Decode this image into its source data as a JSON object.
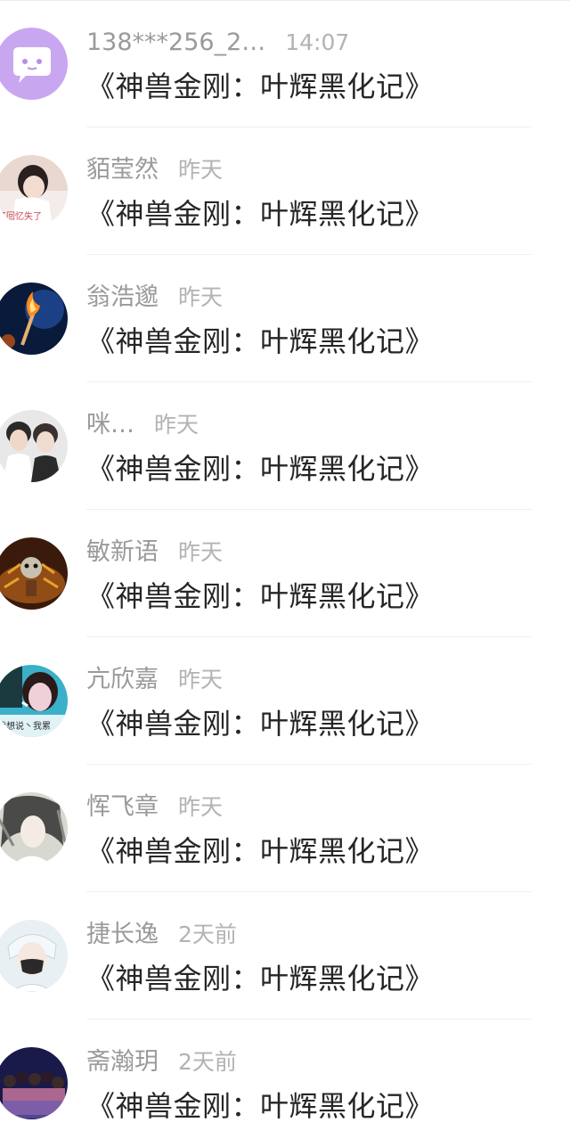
{
  "messages": [
    {
      "name": "138***256_2…",
      "time": "14:07",
      "text": "《神兽金刚：叶辉黑化记》",
      "avatar": "robot-chat-avatar",
      "avatar_colors": [
        "#c9a7f0",
        "#b590e8"
      ]
    },
    {
      "name": "貊莹然",
      "time": "昨天",
      "text": "《神兽金刚：叶辉黑化记》",
      "avatar": "girl-photo-avatar",
      "avatar_colors": [
        "#e8d8d0",
        "#c94a5a"
      ],
      "avatar_caption": "了回忆失了"
    },
    {
      "name": "翁浩邈",
      "time": "昨天",
      "text": "《神兽金刚：叶辉黑化记》",
      "avatar": "burning-match-avatar",
      "avatar_colors": [
        "#0a1a3a",
        "#ff8a1a"
      ]
    },
    {
      "name": "咪…",
      "time": "昨天",
      "text": "《神兽金刚：叶辉黑化记》",
      "avatar": "two-boys-avatar",
      "avatar_colors": [
        "#e8e8e8",
        "#2a2a2a"
      ]
    },
    {
      "name": "敏新语",
      "time": "昨天",
      "text": "《神兽金刚：叶辉黑化记》",
      "avatar": "dark-creature-avatar",
      "avatar_colors": [
        "#3a1a0a",
        "#e8a030"
      ]
    },
    {
      "name": "亢欣嘉",
      "time": "昨天",
      "text": "《神兽金刚：叶辉黑化记》",
      "avatar": "girl-smoking-avatar",
      "avatar_colors": [
        "#3bb0c9",
        "#f0d0d8"
      ],
      "avatar_caption": "我想说丶我累"
    },
    {
      "name": "恽飞章",
      "time": "昨天",
      "text": "《神兽金刚：叶辉黑化记》",
      "avatar": "anime-boy-avatar",
      "avatar_colors": [
        "#d8d8d0",
        "#4a4a48"
      ]
    },
    {
      "name": "捷长逸",
      "time": "2天前",
      "text": "《神兽金刚：叶辉黑化记》",
      "avatar": "masked-boy-avatar",
      "avatar_colors": [
        "#e8f0f4",
        "#2a2a2a"
      ]
    },
    {
      "name": "斋瀚玥",
      "time": "2天前",
      "text": "《神兽金刚：叶辉黑化记》",
      "avatar": "group-photo-avatar",
      "avatar_colors": [
        "#1a1a4a",
        "#d07aa0"
      ]
    }
  ]
}
